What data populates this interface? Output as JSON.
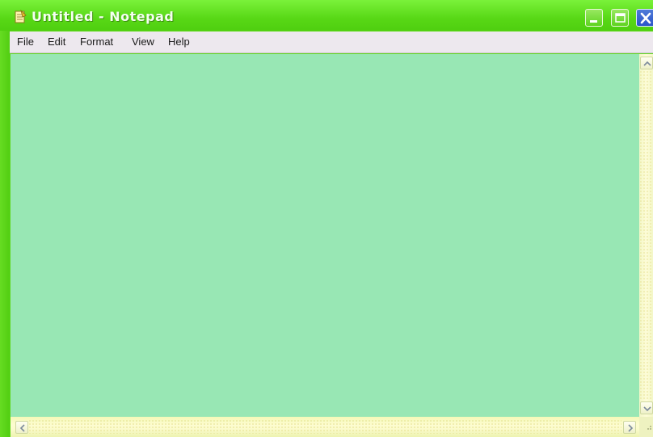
{
  "window": {
    "title": "Untitled - Notepad",
    "app_icon": "notepad-icon",
    "controls": {
      "minimize": "minimize-icon",
      "maximize": "maximize-icon",
      "close": "close-icon"
    }
  },
  "menu": {
    "items": [
      {
        "label": "File"
      },
      {
        "label": "Edit"
      },
      {
        "label": "Format"
      },
      {
        "label": "View"
      },
      {
        "label": "Help"
      }
    ]
  },
  "editor": {
    "content": ""
  },
  "scrollbars": {
    "vertical": {
      "up": "arrow-up-icon",
      "down": "arrow-down-icon"
    },
    "horizontal": {
      "left": "arrow-left-icon",
      "right": "arrow-right-icon"
    }
  },
  "colors": {
    "titlebar": "#58d816",
    "menubar": "#ede8ee",
    "editor_bg": "#98e7b4",
    "scrollbar": "#fdfcd8",
    "close_button": "#2b55c8"
  }
}
